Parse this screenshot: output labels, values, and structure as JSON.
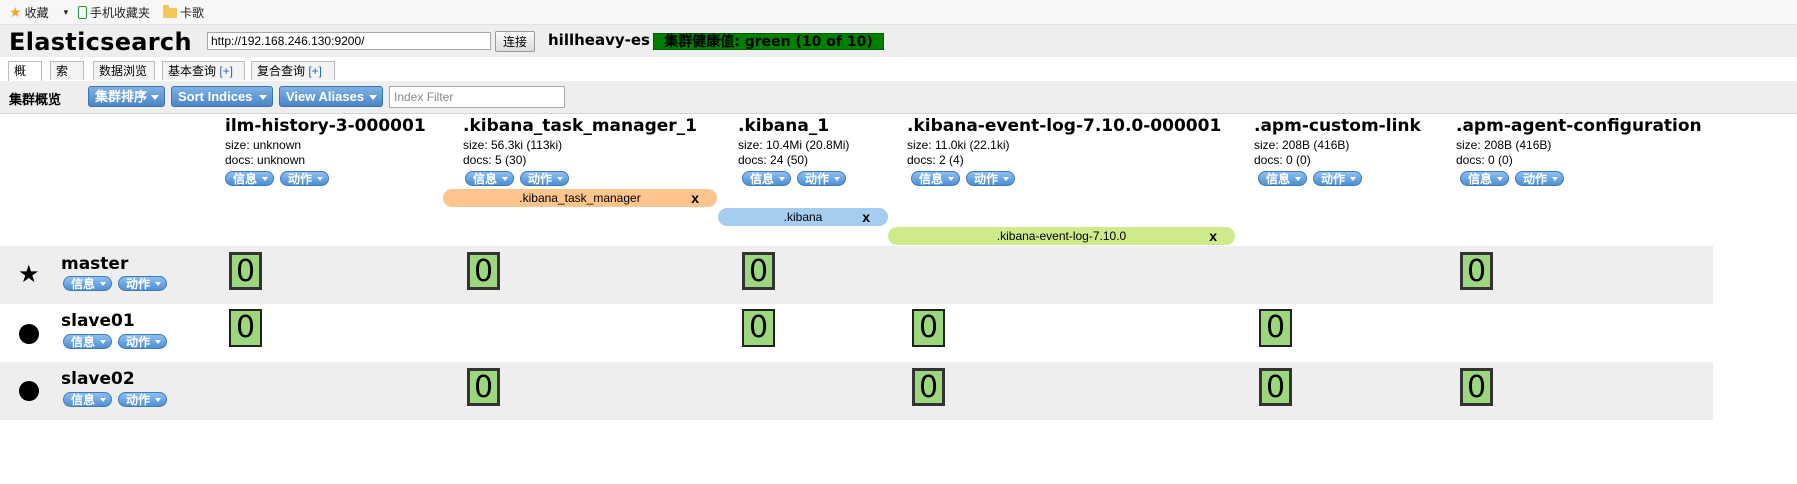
{
  "bookmarks": {
    "favorites_label": "收藏",
    "mobile_label": "手机收藏夹",
    "folder_label": "卡歌"
  },
  "header": {
    "app_title": "Elasticsearch",
    "url_value": "http://192.168.246.130:9200/",
    "connect_label": "连接",
    "cluster_name": "hillheavy-es",
    "health_text": "集群健康值: green (10 of 10)",
    "health_color": "#008000"
  },
  "tabs": [
    {
      "label": "概览",
      "plus": ""
    },
    {
      "label": "索引",
      "plus": ""
    },
    {
      "label": "数据浏览",
      "plus": ""
    },
    {
      "label": "基本查询 ",
      "plus": "[+]"
    },
    {
      "label": "复合查询 ",
      "plus": "[+]"
    }
  ],
  "toolbar": {
    "title": "集群概览",
    "cluster_sort": "集群排序",
    "sort_indices": "Sort Indices",
    "view_aliases": "View Aliases",
    "filter_placeholder": "Index Filter"
  },
  "common": {
    "info_label": "信息",
    "action_label": "动作"
  },
  "indices": [
    {
      "name": "ilm-history-3-000001",
      "size": "size: unknown",
      "docs": "docs: unknown"
    },
    {
      "name": ".kibana_task_manager_1",
      "size": "size: 56.3ki (113ki)",
      "docs": "docs: 5 (30)"
    },
    {
      "name": ".kibana_1",
      "size": "size: 10.4Mi (20.8Mi)",
      "docs": "docs: 24 (50)"
    },
    {
      "name": ".kibana-event-log-7.10.0-000001",
      "size": "size: 11.0ki (22.1ki)",
      "docs": "docs: 2 (4)"
    },
    {
      "name": ".apm-custom-link",
      "size": "size: 208B (416B)",
      "docs": "docs: 0 (0)"
    },
    {
      "name": ".apm-agent-configuration",
      "size": "size: 208B (416B)",
      "docs": "docs: 0 (0)"
    }
  ],
  "aliases": [
    {
      "label": ".kibana_task_manager",
      "close": "x",
      "color": "#fdc58d"
    },
    {
      "label": ".kibana",
      "close": "x",
      "color": "#a4cdef"
    },
    {
      "label": ".kibana-event-log-7.10.0",
      "close": "x",
      "color": "#cdeb8b"
    }
  ],
  "nodes": [
    {
      "name": "master",
      "icon": "star-icon"
    },
    {
      "name": "slave01",
      "icon": "circle-icon"
    },
    {
      "name": "slave02",
      "icon": "circle-icon"
    }
  ],
  "shards": {
    "value": "0",
    "color": "#9cd77d"
  }
}
